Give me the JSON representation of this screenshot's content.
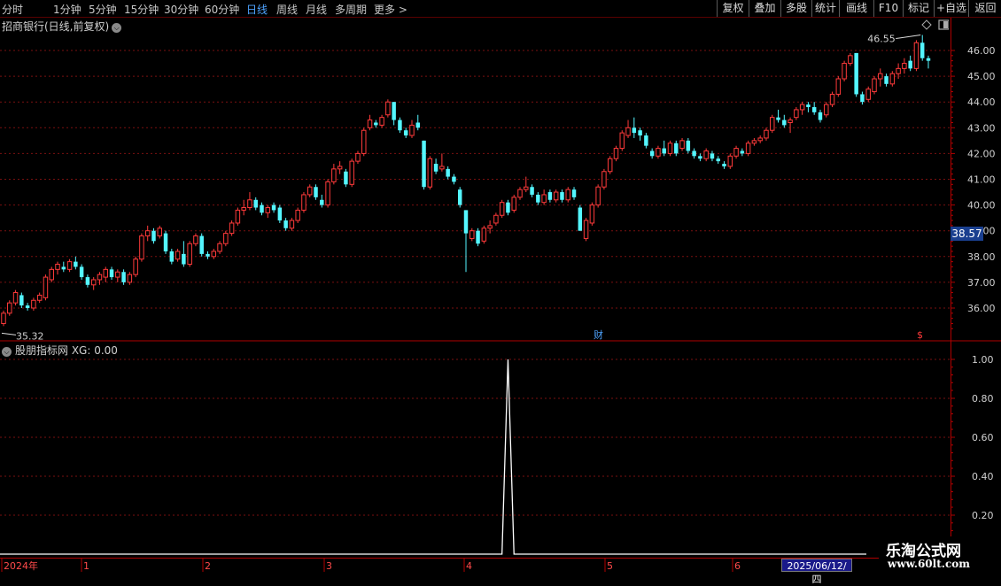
{
  "toolbar": {
    "periods": [
      "分时",
      "1分钟",
      "5分钟",
      "15分钟",
      "30分钟",
      "60分钟",
      "日线",
      "周线",
      "月线",
      "多周期",
      "更多 >"
    ],
    "active_period": "日线",
    "buttons": [
      "复权",
      "叠加",
      "多股",
      "统计",
      "画线",
      "F10",
      "标记",
      "+自选",
      "返回"
    ]
  },
  "chart": {
    "title": "招商银行(日线,前复权)",
    "high_label": "46.55",
    "low_label": "35.32",
    "current_price": "38.57",
    "marker_cai": "财",
    "marker_dollar": "$",
    "price_ticks": [
      "46.00",
      "45.00",
      "44.00",
      "43.00",
      "42.00",
      "41.00",
      "40.00",
      "39.00",
      "38.00",
      "37.00",
      "36.00"
    ],
    "colors": {
      "up": "#ff3a3a",
      "down": "#54f6ff",
      "grid": "#7a1010",
      "border": "#b00000"
    }
  },
  "indicator": {
    "title": "股朋指标网 XG: 0.00",
    "ticks": [
      "1.00",
      "0.80",
      "0.60",
      "0.40",
      "0.20"
    ]
  },
  "time_axis": {
    "labels": [
      "2024年",
      "1",
      "2",
      "3",
      "4",
      "5",
      "6"
    ],
    "current_date": "2025/06/12/四"
  },
  "watermark": {
    "name": "乐淘公式网",
    "url": "www.60lt.com"
  },
  "chart_data": {
    "type": "candlestick",
    "title": "招商银行(日线,前复权)",
    "price_range": [
      35.2,
      46.9
    ],
    "candles": [
      [
        35.4,
        35.9,
        35.3,
        35.8
      ],
      [
        35.8,
        36.3,
        35.7,
        36.2
      ],
      [
        36.2,
        36.7,
        36.1,
        36.6
      ],
      [
        36.5,
        36.6,
        36.0,
        36.1
      ],
      [
        36.1,
        36.2,
        35.9,
        36.0
      ],
      [
        36.0,
        36.4,
        35.9,
        36.3
      ],
      [
        36.3,
        36.6,
        36.2,
        36.5
      ],
      [
        36.4,
        37.3,
        36.3,
        37.2
      ],
      [
        37.1,
        37.6,
        37.0,
        37.5
      ],
      [
        37.5,
        37.8,
        37.3,
        37.7
      ],
      [
        37.6,
        37.8,
        37.4,
        37.5
      ],
      [
        37.5,
        37.9,
        37.4,
        37.8
      ],
      [
        37.8,
        38.0,
        37.5,
        37.6
      ],
      [
        37.6,
        37.7,
        37.1,
        37.2
      ],
      [
        37.2,
        37.3,
        36.8,
        36.9
      ],
      [
        36.9,
        37.2,
        36.7,
        37.1
      ],
      [
        37.1,
        37.4,
        36.9,
        37.3
      ],
      [
        37.2,
        37.6,
        37.0,
        37.5
      ],
      [
        37.5,
        37.6,
        37.1,
        37.2
      ],
      [
        37.2,
        37.5,
        37.0,
        37.4
      ],
      [
        37.4,
        37.5,
        36.9,
        37.0
      ],
      [
        37.0,
        37.4,
        36.9,
        37.3
      ],
      [
        37.3,
        38.0,
        37.2,
        37.9
      ],
      [
        37.9,
        38.9,
        37.8,
        38.8
      ],
      [
        38.8,
        39.2,
        38.6,
        39.0
      ],
      [
        39.0,
        39.1,
        38.5,
        38.6
      ],
      [
        38.8,
        39.2,
        38.7,
        39.1
      ],
      [
        38.9,
        39.0,
        38.1,
        38.2
      ],
      [
        38.2,
        38.3,
        37.7,
        37.8
      ],
      [
        37.9,
        38.3,
        37.8,
        38.2
      ],
      [
        38.1,
        38.6,
        37.6,
        37.7
      ],
      [
        37.7,
        38.6,
        37.6,
        38.5
      ],
      [
        38.5,
        38.9,
        38.4,
        38.8
      ],
      [
        38.8,
        38.9,
        38.0,
        38.1
      ],
      [
        38.1,
        38.2,
        37.9,
        38.0
      ],
      [
        38.0,
        38.3,
        37.9,
        38.2
      ],
      [
        38.2,
        38.6,
        38.1,
        38.5
      ],
      [
        38.5,
        39.0,
        38.4,
        38.9
      ],
      [
        38.9,
        39.4,
        38.8,
        39.3
      ],
      [
        39.3,
        39.9,
        39.2,
        39.8
      ],
      [
        39.8,
        40.2,
        39.6,
        39.9
      ],
      [
        39.9,
        40.5,
        39.8,
        40.2
      ],
      [
        40.2,
        40.3,
        39.8,
        39.9
      ],
      [
        40.0,
        40.1,
        39.6,
        39.7
      ],
      [
        39.7,
        40.0,
        39.5,
        39.9
      ],
      [
        40.0,
        40.1,
        39.7,
        39.8
      ],
      [
        39.9,
        40.0,
        39.3,
        39.4
      ],
      [
        39.4,
        39.5,
        39.0,
        39.1
      ],
      [
        39.1,
        39.5,
        39.0,
        39.4
      ],
      [
        39.4,
        39.9,
        39.3,
        39.8
      ],
      [
        39.8,
        40.5,
        39.7,
        40.4
      ],
      [
        40.4,
        40.8,
        40.3,
        40.7
      ],
      [
        40.7,
        40.8,
        40.2,
        40.3
      ],
      [
        40.2,
        40.4,
        39.9,
        40.0
      ],
      [
        40.0,
        41.0,
        39.9,
        40.9
      ],
      [
        40.9,
        41.6,
        40.8,
        41.4
      ],
      [
        41.4,
        41.7,
        41.2,
        41.5
      ],
      [
        41.3,
        41.4,
        40.7,
        40.8
      ],
      [
        40.8,
        41.8,
        40.7,
        41.7
      ],
      [
        41.7,
        42.1,
        41.6,
        42.0
      ],
      [
        42.0,
        43.0,
        41.9,
        42.9
      ],
      [
        43.0,
        43.5,
        42.9,
        43.3
      ],
      [
        43.2,
        43.3,
        43.0,
        43.1
      ],
      [
        43.1,
        43.5,
        43.0,
        43.4
      ],
      [
        43.5,
        44.1,
        43.4,
        44.0
      ],
      [
        44.0,
        44.0,
        43.1,
        43.3
      ],
      [
        43.3,
        43.4,
        42.8,
        42.9
      ],
      [
        42.9,
        43.0,
        42.6,
        42.7
      ],
      [
        42.7,
        43.3,
        42.6,
        43.1
      ],
      [
        43.2,
        43.5,
        42.9,
        43.0
      ],
      [
        42.5,
        42.5,
        40.6,
        40.7
      ],
      [
        40.7,
        41.9,
        40.6,
        41.8
      ],
      [
        41.6,
        41.8,
        41.2,
        41.3
      ],
      [
        41.4,
        42.0,
        41.3,
        41.5
      ],
      [
        41.4,
        41.5,
        41.0,
        41.1
      ],
      [
        41.1,
        41.2,
        40.8,
        40.9
      ],
      [
        40.6,
        40.7,
        39.9,
        40.0
      ],
      [
        39.8,
        39.8,
        37.4,
        38.9
      ],
      [
        38.7,
        39.1,
        38.6,
        39.0
      ],
      [
        39.0,
        39.1,
        38.4,
        38.5
      ],
      [
        38.6,
        39.2,
        38.5,
        39.1
      ],
      [
        39.1,
        39.4,
        38.9,
        39.2
      ],
      [
        39.3,
        39.7,
        39.2,
        39.6
      ],
      [
        39.6,
        40.2,
        39.5,
        40.1
      ],
      [
        40.1,
        40.2,
        39.6,
        39.7
      ],
      [
        39.8,
        40.4,
        39.7,
        40.3
      ],
      [
        40.3,
        40.7,
        40.2,
        40.6
      ],
      [
        40.6,
        41.1,
        40.5,
        40.7
      ],
      [
        40.7,
        40.8,
        40.3,
        40.4
      ],
      [
        40.4,
        40.5,
        40.0,
        40.1
      ],
      [
        40.1,
        40.6,
        40.0,
        40.4
      ],
      [
        40.5,
        40.6,
        40.1,
        40.2
      ],
      [
        40.2,
        40.6,
        40.1,
        40.5
      ],
      [
        40.5,
        40.6,
        40.1,
        40.2
      ],
      [
        40.2,
        40.7,
        40.1,
        40.6
      ],
      [
        40.6,
        40.7,
        40.2,
        40.3
      ],
      [
        39.9,
        40.0,
        39.0,
        39.0
      ],
      [
        38.7,
        39.5,
        38.6,
        39.4
      ],
      [
        39.3,
        40.1,
        39.2,
        40.0
      ],
      [
        40.0,
        40.8,
        39.9,
        40.7
      ],
      [
        40.7,
        41.4,
        40.6,
        41.3
      ],
      [
        41.3,
        41.9,
        41.2,
        41.8
      ],
      [
        41.8,
        42.3,
        41.7,
        42.2
      ],
      [
        42.2,
        42.9,
        42.1,
        42.8
      ],
      [
        42.7,
        43.3,
        42.6,
        43.0
      ],
      [
        43.0,
        43.4,
        42.6,
        42.8
      ],
      [
        42.9,
        43.0,
        42.5,
        42.7
      ],
      [
        42.7,
        42.8,
        42.2,
        42.3
      ],
      [
        42.1,
        42.2,
        41.8,
        41.9
      ],
      [
        41.9,
        42.3,
        41.8,
        42.2
      ],
      [
        42.2,
        42.5,
        41.9,
        42.0
      ],
      [
        42.0,
        42.5,
        41.9,
        42.4
      ],
      [
        42.4,
        42.5,
        41.9,
        42.0
      ],
      [
        42.2,
        42.6,
        42.1,
        42.5
      ],
      [
        42.5,
        42.6,
        42.0,
        42.1
      ],
      [
        42.1,
        42.2,
        41.8,
        41.9
      ],
      [
        41.9,
        42.0,
        41.7,
        41.8
      ],
      [
        41.8,
        42.2,
        41.7,
        42.1
      ],
      [
        42.0,
        42.1,
        41.7,
        41.8
      ],
      [
        41.8,
        41.9,
        41.6,
        41.7
      ],
      [
        41.6,
        41.7,
        41.4,
        41.5
      ],
      [
        41.5,
        42.0,
        41.4,
        41.9
      ],
      [
        41.9,
        42.3,
        41.8,
        42.2
      ],
      [
        42.1,
        42.2,
        41.9,
        42.0
      ],
      [
        42.0,
        42.5,
        41.9,
        42.4
      ],
      [
        42.4,
        42.6,
        42.3,
        42.5
      ],
      [
        42.5,
        42.7,
        42.4,
        42.6
      ],
      [
        42.6,
        43.0,
        42.5,
        42.9
      ],
      [
        42.9,
        43.5,
        42.8,
        43.4
      ],
      [
        43.4,
        43.7,
        43.2,
        43.3
      ],
      [
        43.3,
        43.5,
        43.0,
        43.1
      ],
      [
        43.2,
        43.4,
        42.8,
        43.3
      ],
      [
        43.4,
        43.8,
        43.3,
        43.7
      ],
      [
        43.7,
        44.0,
        43.5,
        43.9
      ],
      [
        43.9,
        44.0,
        43.6,
        43.8
      ],
      [
        43.8,
        44.0,
        43.5,
        43.6
      ],
      [
        43.6,
        43.7,
        43.2,
        43.3
      ],
      [
        43.5,
        44.0,
        43.4,
        43.9
      ],
      [
        43.9,
        44.4,
        43.8,
        44.3
      ],
      [
        44.3,
        45.0,
        44.2,
        44.9
      ],
      [
        44.9,
        45.6,
        44.8,
        45.5
      ],
      [
        45.5,
        45.9,
        45.4,
        45.8
      ],
      [
        45.9,
        45.9,
        44.2,
        44.3
      ],
      [
        44.3,
        44.4,
        43.9,
        44.0
      ],
      [
        44.1,
        44.6,
        44.0,
        44.5
      ],
      [
        44.4,
        45.0,
        44.3,
        44.9
      ],
      [
        44.9,
        45.3,
        44.6,
        45.1
      ],
      [
        45.0,
        45.1,
        44.6,
        44.7
      ],
      [
        44.7,
        45.2,
        44.6,
        45.1
      ],
      [
        45.1,
        45.5,
        44.9,
        45.3
      ],
      [
        45.3,
        45.7,
        45.1,
        45.5
      ],
      [
        45.6,
        45.8,
        45.2,
        45.3
      ],
      [
        45.3,
        46.4,
        45.2,
        46.3
      ],
      [
        46.3,
        46.6,
        45.6,
        45.7
      ],
      [
        45.7,
        45.8,
        45.3,
        45.6
      ]
    ],
    "indicator": {
      "name": "XG",
      "signal_index": 84,
      "ylim": [
        0,
        1.05
      ]
    }
  }
}
